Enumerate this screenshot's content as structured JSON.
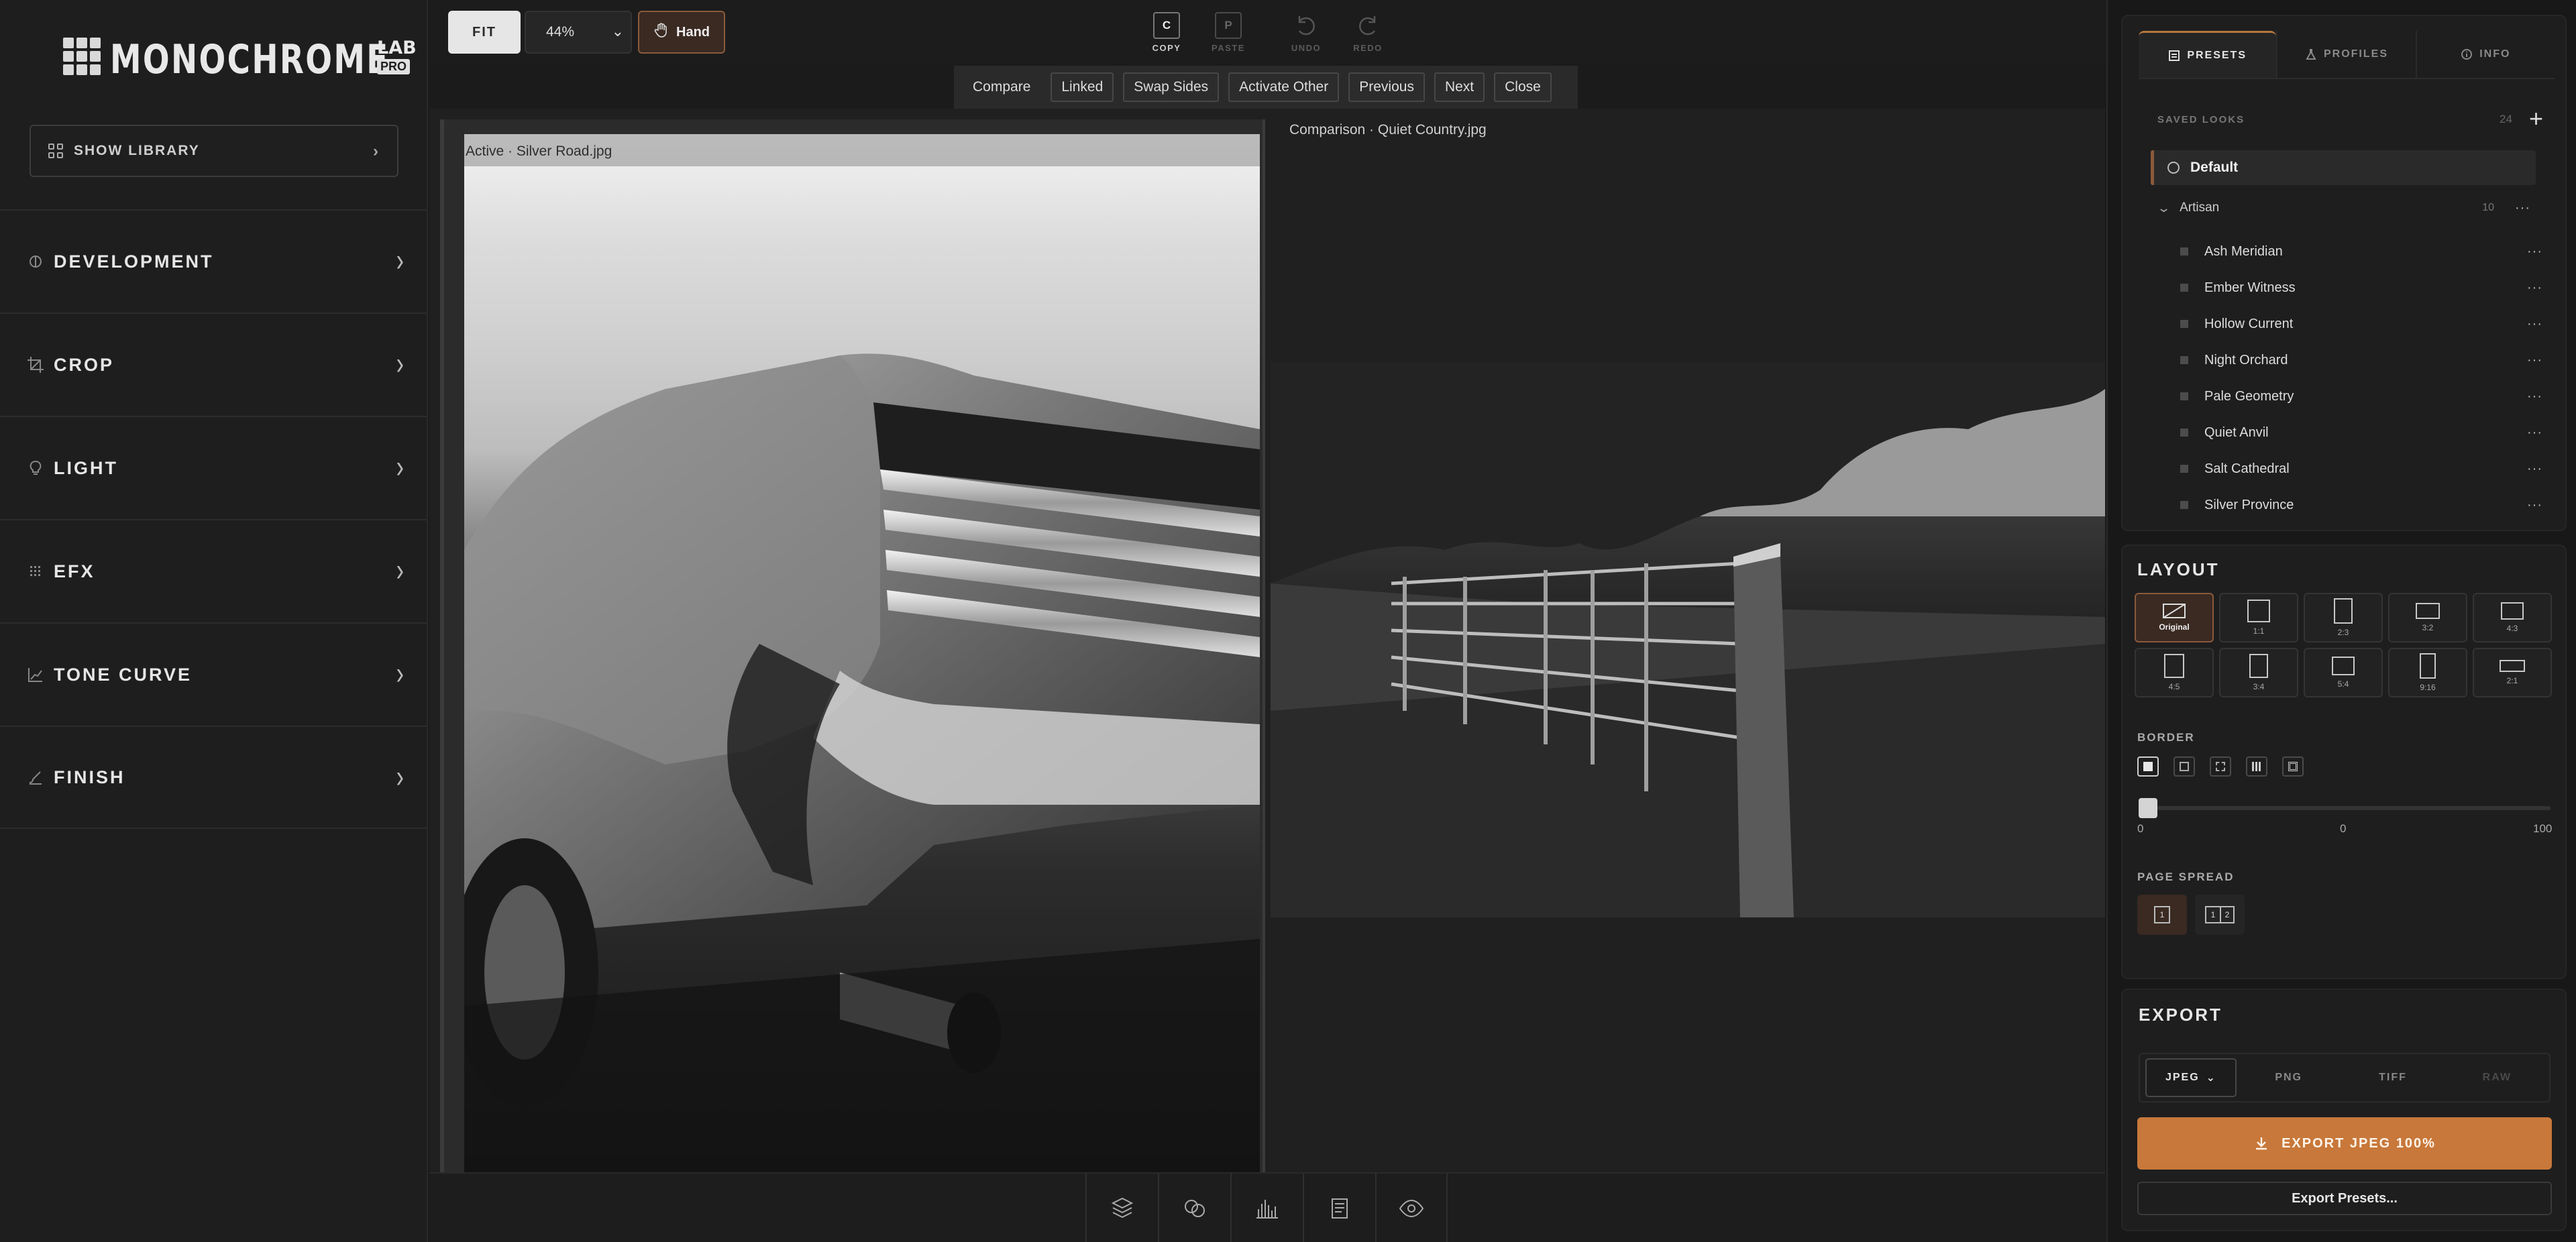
{
  "app": {
    "logo_main": "MONOCHROME",
    "logo_lab": "LAB",
    "logo_pro": "PRO",
    "accent": "#c8783a"
  },
  "sidebar": {
    "show_library": "SHOW LIBRARY",
    "sections": [
      {
        "label": "DEVELOPMENT",
        "icon": "aperture-icon"
      },
      {
        "label": "CROP",
        "icon": "crop-icon"
      },
      {
        "label": "LIGHT",
        "icon": "bulb-icon"
      },
      {
        "label": "EFX",
        "icon": "dots-grid-icon"
      },
      {
        "label": "TONE CURVE",
        "icon": "curve-icon"
      },
      {
        "label": "FINISH",
        "icon": "brush-icon"
      }
    ]
  },
  "toolbar": {
    "fit": "FIT",
    "zoom": "44%",
    "hand": "Hand",
    "copy_key": "C",
    "copy": "COPY",
    "paste_key": "P",
    "paste": "PASTE",
    "undo": "UNDO",
    "redo": "REDO"
  },
  "compare": {
    "compare": "Compare",
    "linked": "Linked",
    "swap": "Swap Sides",
    "activate": "Activate Other",
    "previous": "Previous",
    "next": "Next",
    "close": "Close"
  },
  "viewer": {
    "active_caption": "Active · Silver Road.jpg",
    "comparison_caption": "Comparison · Quiet Country.jpg"
  },
  "bottom": {
    "tools": [
      "layers-icon",
      "channels-icon",
      "histogram-icon",
      "pages-icon",
      "eye-icon"
    ]
  },
  "panel": {
    "tabs": {
      "presets": "PRESETS",
      "profiles": "PROFILES",
      "info": "INFO"
    },
    "saved_looks": "SAVED LOOKS",
    "saved_count": "24",
    "default": "Default",
    "group": "Artisan",
    "group_count": "10",
    "presets": [
      "Ash Meridian",
      "Ember Witness",
      "Hollow Current",
      "Night Orchard",
      "Pale Geometry",
      "Quiet Anvil",
      "Salt Cathedral",
      "Silver Province"
    ]
  },
  "layout": {
    "title": "LAYOUT",
    "ratios": [
      "Original",
      "1:1",
      "2:3",
      "3:2",
      "4:3",
      "4:5",
      "3:4",
      "5:4",
      "9:16",
      "2:1"
    ],
    "border_title": "BORDER",
    "border_min": "0",
    "border_value": "0",
    "border_max": "100",
    "spread_title": "PAGE SPREAD",
    "spread_one": "1",
    "spread_two_a": "1",
    "spread_two_b": "2"
  },
  "export": {
    "title": "EXPORT",
    "formats": {
      "jpeg": "JPEG",
      "png": "PNG",
      "tiff": "TIFF",
      "raw": "RAW"
    },
    "export_button": "EXPORT JPEG 100%",
    "presets_button": "Export Presets..."
  }
}
